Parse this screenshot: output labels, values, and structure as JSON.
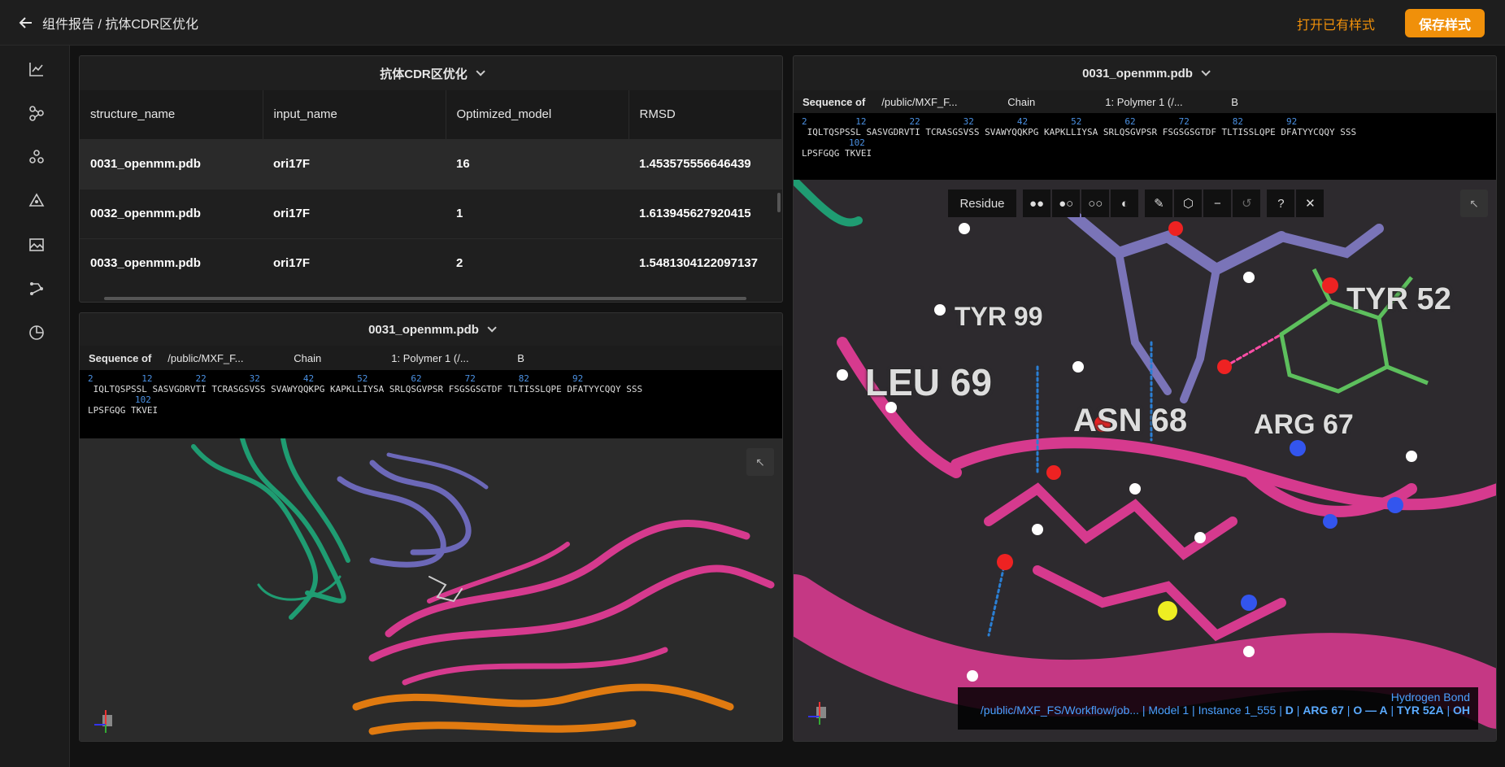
{
  "header": {
    "breadcrumb": "组件报告 / 抗体CDR区优化",
    "open_style": "打开已有样式",
    "save_style": "保存样式"
  },
  "sidebar": {
    "icons": [
      "line-chart-icon",
      "molecule-icon",
      "cluster-icon",
      "network-icon",
      "image-icon",
      "workflow-icon",
      "pie-chart-icon"
    ]
  },
  "table_panel": {
    "title": "抗体CDR区优化",
    "columns": [
      "structure_name",
      "input_name",
      "Optimized_model",
      "RMSD"
    ],
    "rows": [
      [
        "0031_openmm.pdb",
        "ori17F",
        "16",
        "1.453575556646439"
      ],
      [
        "0032_openmm.pdb",
        "ori17F",
        "1",
        "1.613945627920415"
      ],
      [
        "0033_openmm.pdb",
        "ori17F",
        "2",
        "1.5481304122097137"
      ]
    ]
  },
  "left_viewer": {
    "title": "0031_openmm.pdb",
    "seq_label": "Sequence of",
    "path": "/public/MXF_F...",
    "chain_label": "Chain",
    "polymer": "1: Polymer 1 (/...",
    "chain_value": "B",
    "numbers": "2         12        22        32        42        52        62        72        82        92",
    "seq_line1": " IQLTQSPSSL SASVGDRVTI TCRASGSVSS SVAWYQQKPG KAPKLLIYSA SRLQSGVPSR FSGSGSGTDF TLTISSLQPE DFATYYCQQY SSS",
    "num102": "102",
    "seq_line2": "LPSFGQG TKVEI"
  },
  "right_viewer": {
    "title": "0031_openmm.pdb",
    "seq_label": "Sequence of",
    "path": "/public/MXF_F...",
    "chain_label": "Chain",
    "polymer": "1: Polymer 1 (/...",
    "chain_value": "B",
    "numbers": "2         12        22        32        42        52        62        72        82        92",
    "seq_line1": " IQLTQSPSSL SASVGDRVTI TCRASGSVSS SVAWYQQKPG KAPKLLIYSA SRLQSGVPSR FSGSGSGTDF TLTISSLQPE DFATYYCQQY SSS",
    "num102": "102",
    "seq_line2": "LPSFGQG TKVEI",
    "toolbar_mode": "Residue",
    "labels": {
      "tyr99": "TYR 99",
      "tyr52": "TYR 52",
      "leu69": "LEU 69",
      "asn68": "ASN 68",
      "arg67": "ARG 67"
    },
    "hbond_title": "Hydrogen Bond",
    "hbond_path": "/public/MXF_FS/Workflow/job...",
    "hbond_model": "Model 1",
    "hbond_instance": "Instance 1_555",
    "hbond_d": "D",
    "hbond_arg": "ARG 67",
    "hbond_o": "O — A",
    "hbond_tyr": "TYR 52A",
    "hbond_oh": "OH"
  }
}
